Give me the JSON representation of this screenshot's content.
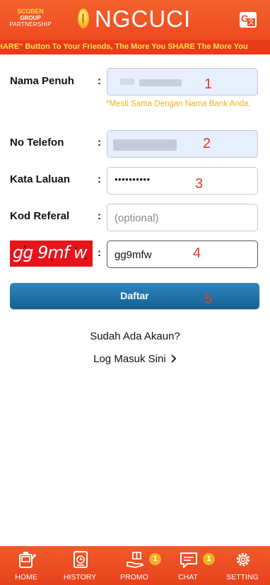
{
  "header": {
    "partner_line1_a": "SCOBEN",
    "partner_line1_b": "GROUP",
    "partner_line3": "PARTNERSHIP",
    "brand": "NGCUCI",
    "translate_icon": "google-translate-icon"
  },
  "marquee": {
    "text": "HARE\" Button To Your Friends, The More You SHARE The More You"
  },
  "form": {
    "full_name": {
      "label": "Nama Penuh",
      "colon": ":",
      "note": "*Mesti Sama Dengan Nama Bank Anda.",
      "step": "1"
    },
    "phone": {
      "label": "No Telefon",
      "colon": ":",
      "step": "2"
    },
    "password": {
      "label": "Kata Laluan",
      "colon": ":",
      "value": "••••••••••",
      "step": "3"
    },
    "referral": {
      "label": "Kod Referal",
      "colon": ":",
      "placeholder": "(optional)"
    },
    "captcha": {
      "image_text": "gg 9mf w",
      "colon": ":",
      "value": "gg9mfw",
      "step": "4"
    },
    "submit": {
      "label": "Daftar",
      "step": "5"
    }
  },
  "login_prompt": {
    "question": "Sudah Ada Akaun?",
    "link": "Log Masuk Sini"
  },
  "bottom_nav": {
    "items": [
      {
        "label": "HOME",
        "icon": "home-slot-icon"
      },
      {
        "label": "HISTORY",
        "icon": "history-icon"
      },
      {
        "label": "PROMO",
        "icon": "promo-gift-icon",
        "badge": "1"
      },
      {
        "label": "CHAT",
        "icon": "chat-icon",
        "badge": "1"
      },
      {
        "label": "SETTING",
        "icon": "settings-gear-icon"
      }
    ]
  },
  "colors": {
    "header": "#ee4a20",
    "marquee_text": "#ffe14a",
    "accent_number": "#e23b2b",
    "button": "#1f6fa6",
    "note": "#f2b21a"
  }
}
